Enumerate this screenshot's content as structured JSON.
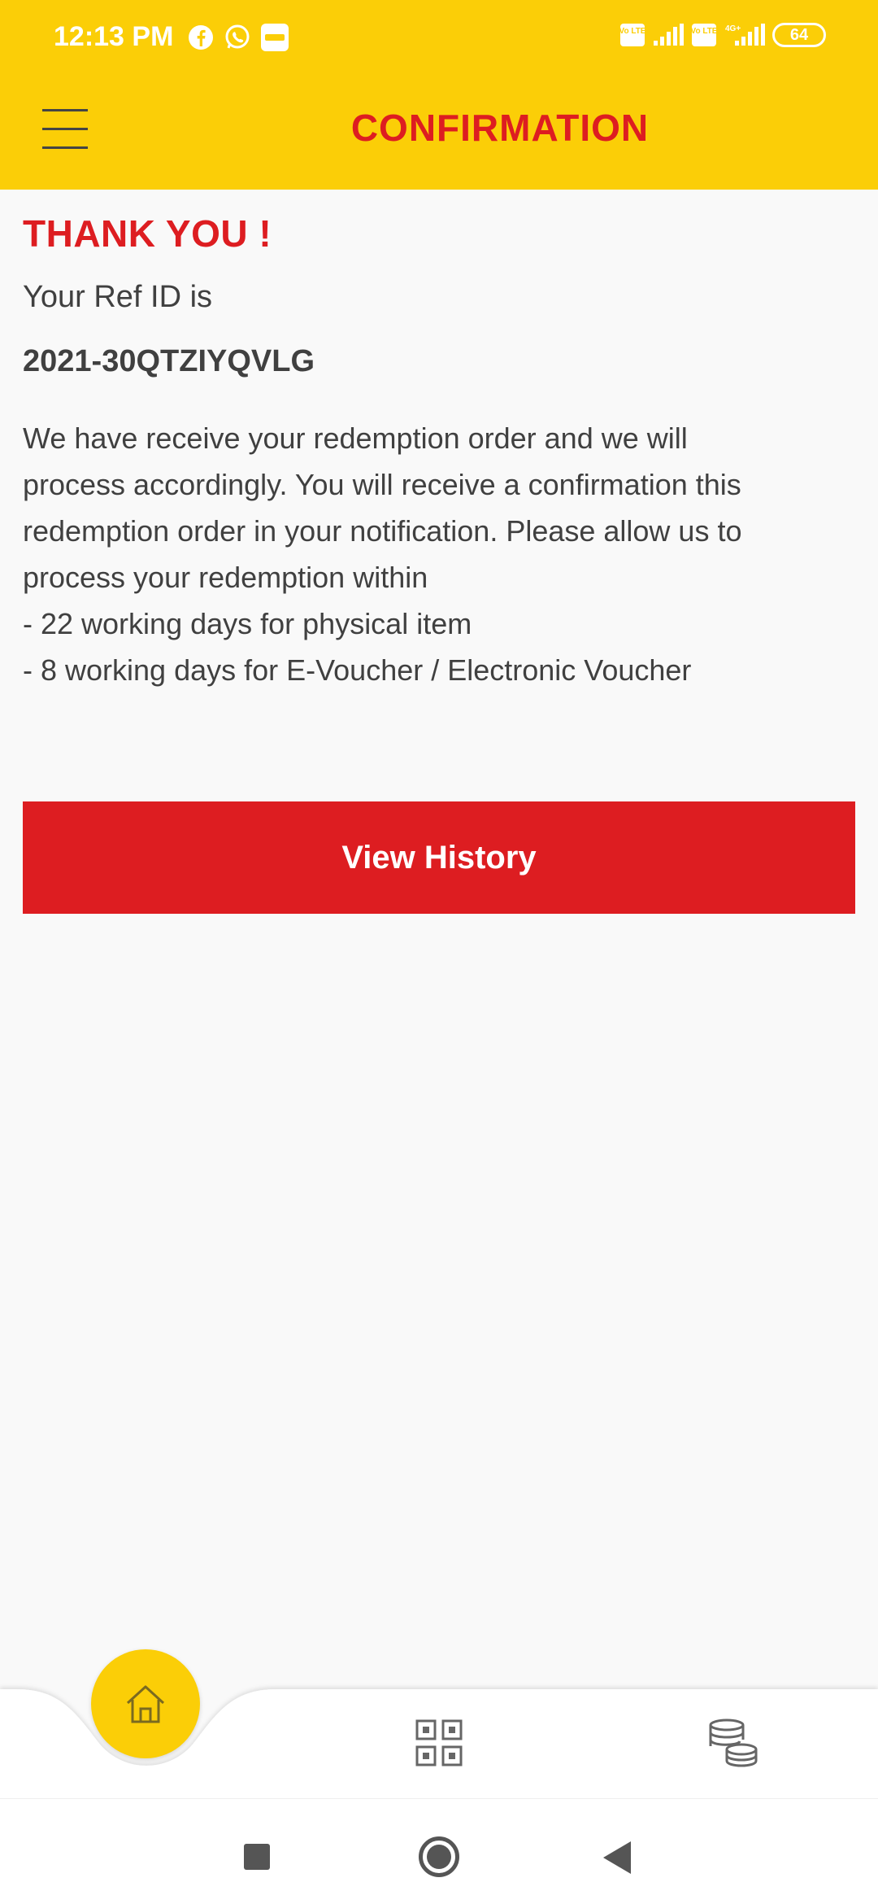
{
  "status_bar": {
    "time": "12:13 PM",
    "app_icons": [
      "facebook-icon",
      "whatsapp-icon",
      "paytm-icon"
    ],
    "network_icons": [
      "volte-icon",
      "signal-icon",
      "volte-icon",
      "4g-signal-icon"
    ],
    "network_labels": {
      "volte": "Vo LTE",
      "fourg": "4G+"
    },
    "battery": "64"
  },
  "header": {
    "title": "CONFIRMATION",
    "menu_icon": "hamburger-menu-icon"
  },
  "content": {
    "heading": "THANK YOU !",
    "ref_label": "Your Ref ID is",
    "ref_id": "2021-30QTZIYQVLG",
    "message_lines": [
      "We have receive your redemption order and we will",
      "process accordingly. You will receive a confirmation this",
      "redemption order in your notification. Please allow us to",
      "process your redemption within",
      "- 22 working days for physical item",
      "- 8 working days for E-Voucher / Electronic Voucher"
    ]
  },
  "actions": {
    "view_history": "View History"
  },
  "bottom_nav": {
    "items": [
      {
        "icon": "home-icon",
        "active": true
      },
      {
        "icon": "qr-code-icon",
        "active": false
      },
      {
        "icon": "coins-icon",
        "active": false
      }
    ]
  },
  "colors": {
    "brand_yellow": "#fbce07",
    "brand_red": "#dd1d21",
    "text": "#404040",
    "background": "#f9f9f9"
  }
}
